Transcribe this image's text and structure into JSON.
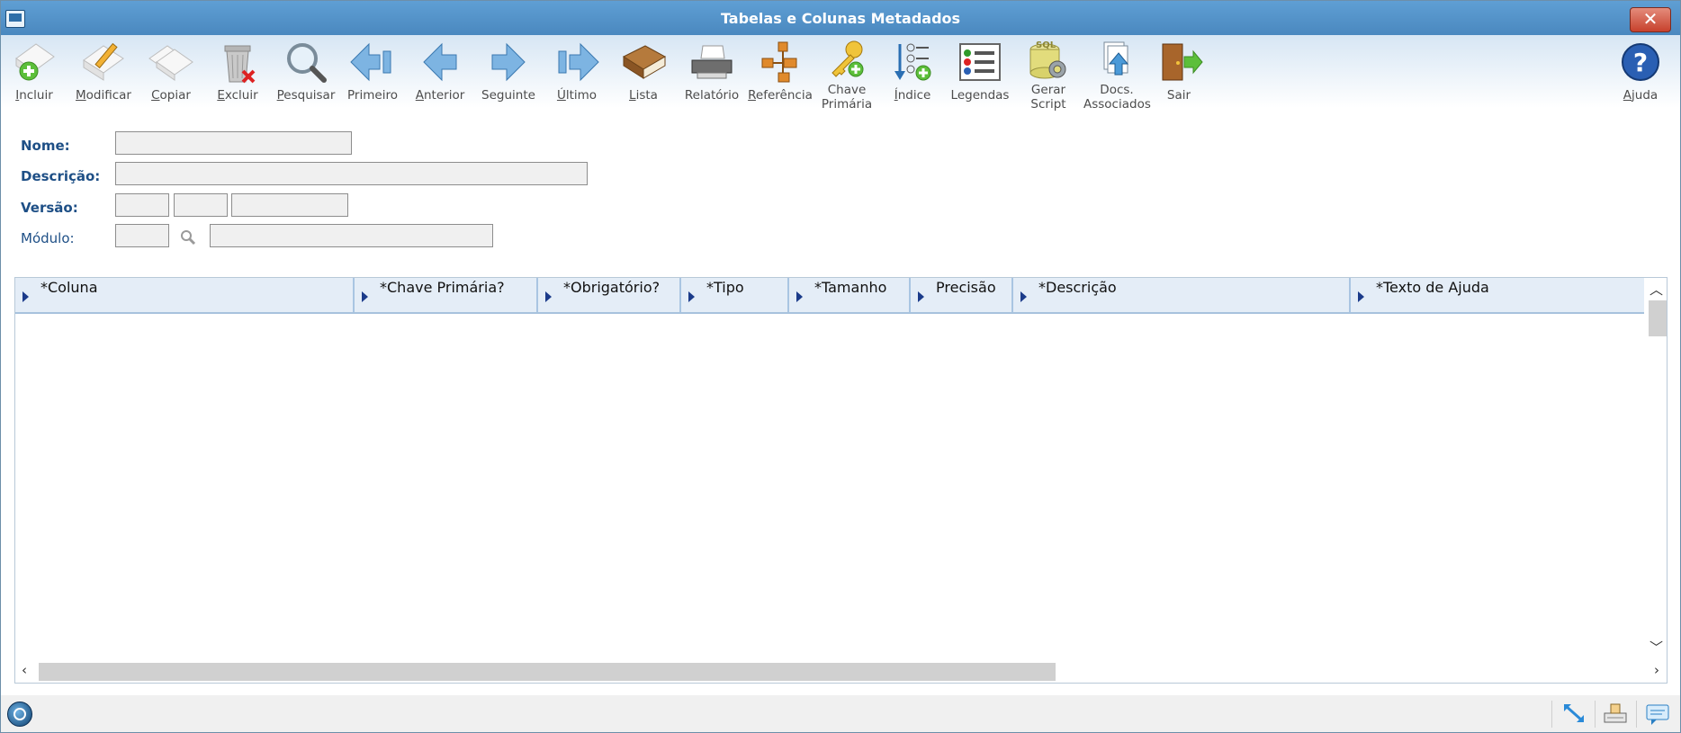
{
  "window": {
    "title": "Tabelas e Colunas Metadados",
    "close_label": "✕"
  },
  "toolbar": {
    "buttons": [
      {
        "label": "Incluir",
        "icon": "add-document-icon"
      },
      {
        "label": "Modificar",
        "icon": "edit-document-icon"
      },
      {
        "label": "Copiar",
        "icon": "copy-document-icon"
      },
      {
        "label": "Excluir",
        "icon": "trash-icon"
      },
      {
        "label": "Pesquisar",
        "icon": "magnifier-icon"
      },
      {
        "label": "Primeiro",
        "icon": "first-arrow-icon"
      },
      {
        "label": "Anterior",
        "icon": "previous-arrow-icon"
      },
      {
        "label": "Seguinte",
        "icon": "next-arrow-icon"
      },
      {
        "label": "Último",
        "icon": "last-arrow-icon"
      },
      {
        "label": "Lista",
        "icon": "book-icon"
      },
      {
        "label": "Relatório",
        "icon": "printer-icon"
      },
      {
        "label": "Referência",
        "icon": "hierarchy-icon"
      },
      {
        "label": "Chave",
        "label2": "Primária",
        "icon": "key-icon"
      },
      {
        "label": "Índice",
        "icon": "index-icon"
      },
      {
        "label": "Legendas",
        "icon": "legend-icon"
      },
      {
        "label": "Gerar",
        "label2": "Script",
        "icon": "sql-script-icon",
        "badge": "SQL"
      },
      {
        "label": "Docs.",
        "label2": "Associados",
        "icon": "associated-docs-icon"
      },
      {
        "label": "Sair",
        "icon": "exit-door-icon"
      }
    ],
    "help": {
      "label": "Ajuda",
      "icon": "help-icon",
      "glyph": "?"
    }
  },
  "form": {
    "nome_label": "Nome:",
    "descricao_label": "Descrição:",
    "versao_label": "Versão:",
    "modulo_label": "Módulo:"
  },
  "grid": {
    "columns": [
      "*Coluna",
      "*Chave Primária?",
      "*Obrigatório?",
      "*Tipo",
      "*Tamanho",
      "Precisão",
      "*Descrição",
      "*Texto de Ajuda"
    ]
  },
  "colors": {
    "title_bar": "#5f9fd4",
    "label": "#1e4f86",
    "grid_header": "#e4edf7"
  }
}
